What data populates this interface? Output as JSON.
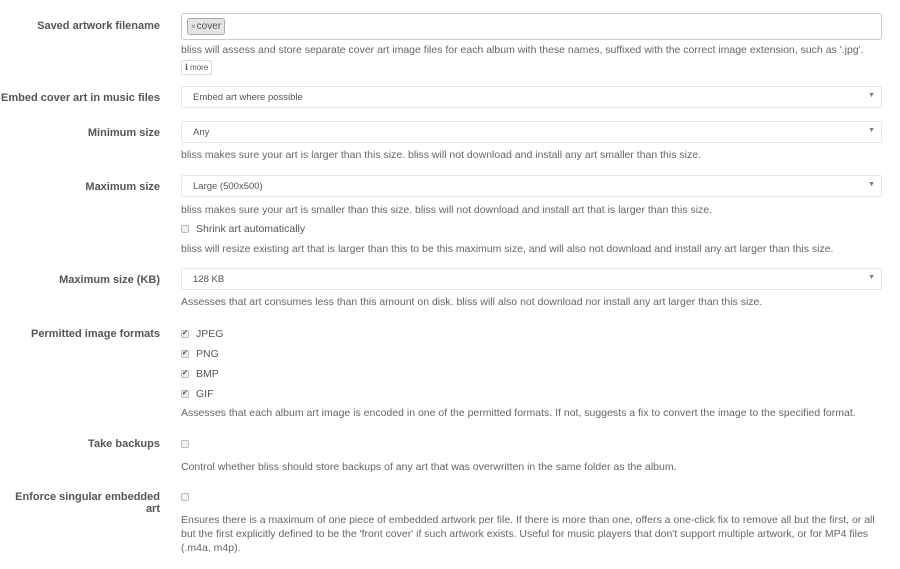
{
  "saved_artwork": {
    "label": "Saved artwork filename",
    "tags": [
      {
        "remove_glyph": "×",
        "text": "cover"
      }
    ],
    "help": "bliss will assess and store separate cover art image files for each album with these names, suffixed with the correct image extension, such as '.jpg'.",
    "more_icon": "i",
    "more_label": "more"
  },
  "embed": {
    "label": "Embed cover art in music files",
    "value": "Embed art where possible"
  },
  "min_size": {
    "label": "Minimum size",
    "value": "Any",
    "help": "bliss makes sure your art is larger than this size. bliss will not download and install any art smaller than this size."
  },
  "max_size": {
    "label": "Maximum size",
    "value": "Large (500x500)",
    "help": "bliss makes sure your art is smaller than this size. bliss will not download and install art that is larger than this size.",
    "shrink_label": "Shrink art automatically",
    "shrink_checked": false,
    "shrink_help": "bliss will resize existing art that is larger than this to be this maximum size, and will also not download and install any art larger than this size."
  },
  "max_kb": {
    "label": "Maximum size (KB)",
    "value": "128 KB",
    "help": "Assesses that art consumes less than this amount on disk. bliss will also not download nor install any art larger than this size."
  },
  "formats": {
    "label": "Permitted image formats",
    "options": [
      {
        "label": "JPEG",
        "checked": true
      },
      {
        "label": "PNG",
        "checked": true
      },
      {
        "label": "BMP",
        "checked": true
      },
      {
        "label": "GIF",
        "checked": true
      }
    ],
    "help": "Assesses that each album art image is encoded in one of the permitted formats. If not, suggests a fix to convert the image to the specified format."
  },
  "backups": {
    "label": "Take backups",
    "checked": false,
    "help": "Control whether bliss should store backups of any art that was overwritten in the same folder as the album."
  },
  "singular": {
    "label": "Enforce singular embedded art",
    "checked": false,
    "help": "Ensures there is a maximum of one piece of embedded artwork per file. If there is more than one, offers a one-click fix to remove all but the first, or all but the first explicitly defined to be the 'front cover' if such artwork exists. Useful for music players that don't support multiple artwork, or for MP4 files (.m4a, m4p)."
  },
  "caret_glyph": "▼"
}
